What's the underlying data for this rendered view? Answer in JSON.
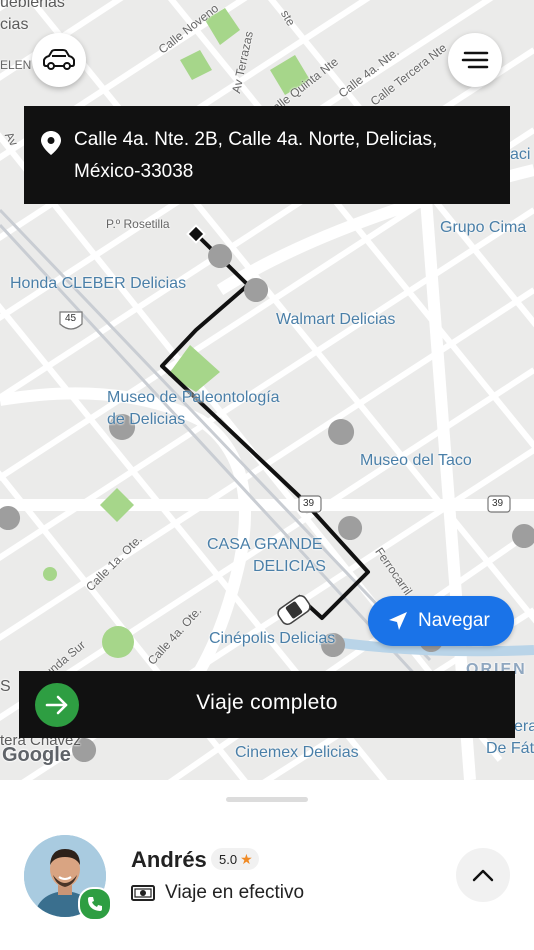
{
  "map": {
    "labels": {
      "top_left_partial": "uebierias",
      "cias": "cias",
      "elen": "ELEN",
      "av_partial": "Av",
      "aci": "aci",
      "calle_noveno": "Calle Noveno",
      "av_terrazas": "Av Terrazas",
      "calle_quinta": "alle Quinta Nte",
      "calle_4a_top": "Calle 4a. Nte.",
      "calle_tercera": "Calle Tercera Nte",
      "ste": "ste",
      "p_rosetilla": "P.º Rosetilla",
      "grupo_cima": "Grupo Cima",
      "honda": "Honda CLEBER Delicias",
      "walmart": "Walmart Delicias",
      "museo_paleo_1": "Museo de Paleontología",
      "museo_paleo_2": "de Delicias",
      "museo_taco": "Museo del Taco",
      "casa_grande_1": "CASA GRANDE",
      "casa_grande_2": "DELICIAS",
      "ferrocarril": "Ferrocarril",
      "calle_1a": "Calle 1a. Ote.",
      "calle_4a_ote": "Calle 4a. Ote.",
      "segunda_sur": "egunda Sur",
      "cinepolis": "Cinépolis Delicias",
      "orien": "ORIEN",
      "s_left": "S",
      "tera_chavez": "tera Chávez",
      "cinemex": "Cinemex Delicias",
      "era": "era",
      "de_fat": "De Fát",
      "shield_45": "45",
      "shield_39_a": "39",
      "shield_39_b": "39",
      "google": "Google"
    }
  },
  "top_bar": {
    "left_icon": "car-icon",
    "right_icon": "menu-icon"
  },
  "address": {
    "icon": "location-pin-icon",
    "text": "Calle 4a. Nte. 2B, Calle 4a. Norte, Delicias, México-33038"
  },
  "navigate": {
    "icon": "navigation-arrow-icon",
    "label": "Navegar"
  },
  "trip_complete": {
    "icon": "arrow-right-icon",
    "label": "Viaje completo"
  },
  "driver": {
    "name": "Andrés",
    "rating": "5.0",
    "rating_icon": "star-icon",
    "payment_icon": "cash-icon",
    "payment_label": "Viaje en efectivo",
    "call_icon": "phone-icon",
    "expand_icon": "chevron-up-icon"
  },
  "colors": {
    "route": "#111111",
    "navigate_button": "#1a73e8",
    "complete_button": "#2e9e42",
    "dark_panel": "#111111",
    "star": "#f08a24"
  }
}
